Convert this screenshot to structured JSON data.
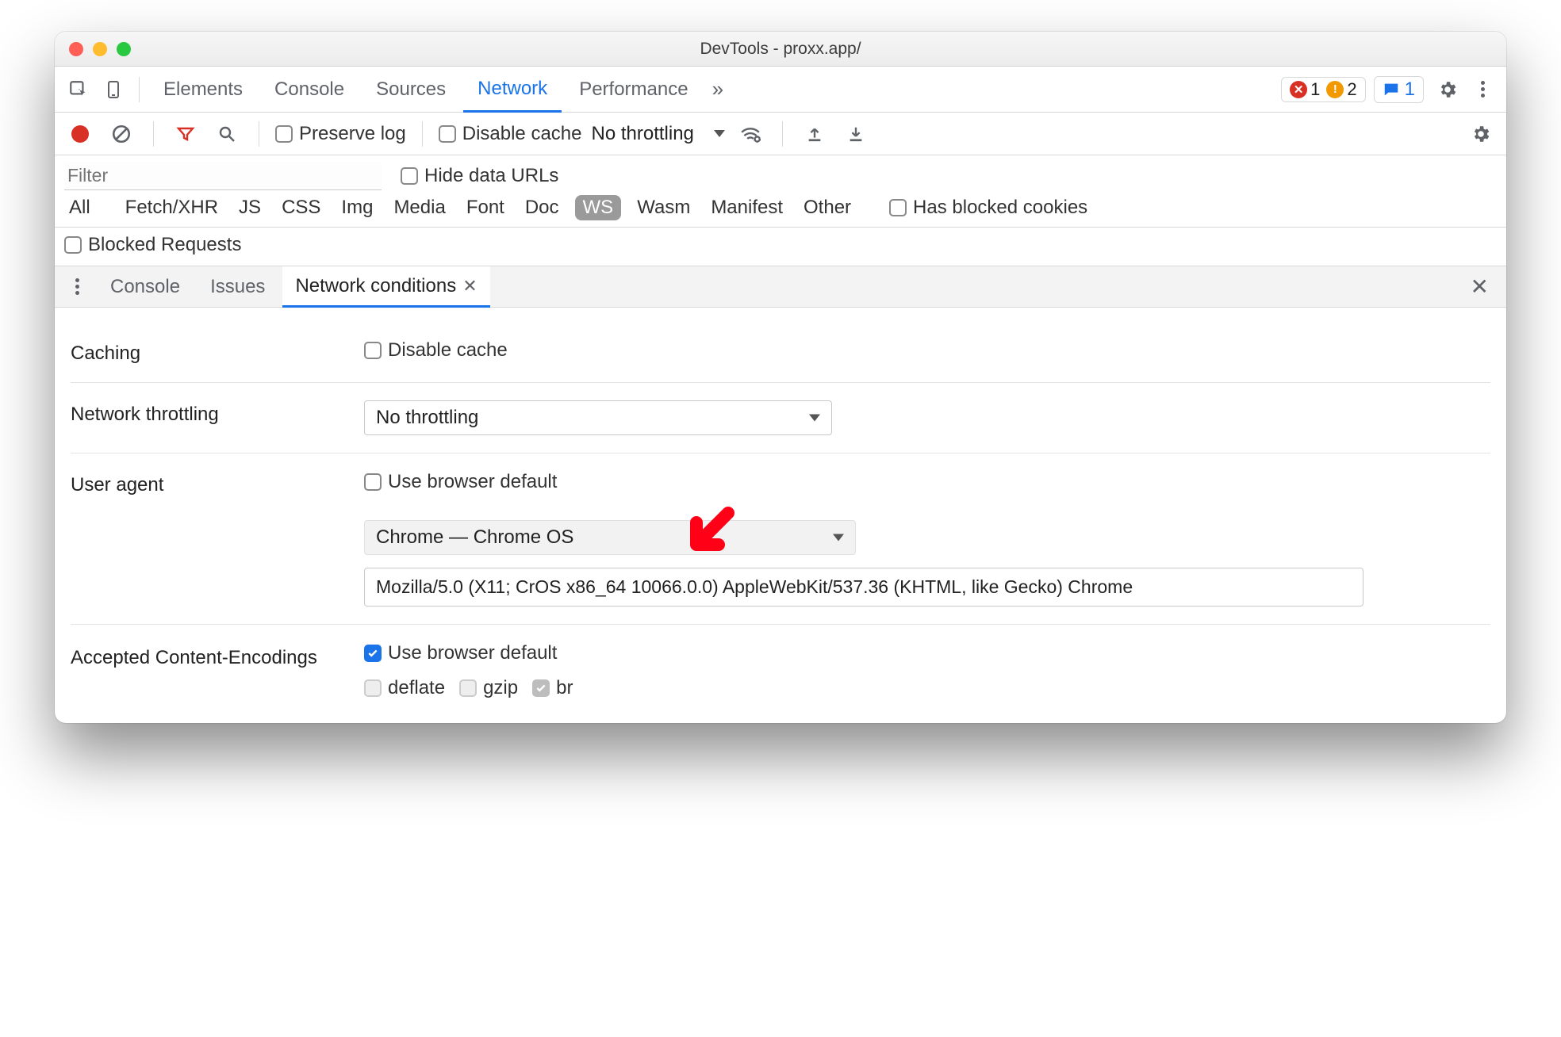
{
  "window": {
    "title": "DevTools - proxx.app/"
  },
  "main_tabs": {
    "items": [
      "Elements",
      "Console",
      "Sources",
      "Network",
      "Performance"
    ],
    "active": "Network",
    "overflow_icon": "»",
    "error_count": "1",
    "warn_count": "2",
    "msg_count": "1"
  },
  "net_toolbar": {
    "preserve_log": "Preserve log",
    "disable_cache": "Disable cache",
    "throttling": "No throttling"
  },
  "filter": {
    "placeholder": "Filter",
    "hide_data_urls": "Hide data URLs",
    "chips": [
      "All",
      "Fetch/XHR",
      "JS",
      "CSS",
      "Img",
      "Media",
      "Font",
      "Doc",
      "WS",
      "Wasm",
      "Manifest",
      "Other"
    ],
    "has_blocked": "Has blocked cookies",
    "blocked_requests": "Blocked Requests"
  },
  "drawer": {
    "tabs": [
      "Console",
      "Issues",
      "Network conditions"
    ],
    "active": "Network conditions"
  },
  "conditions": {
    "caching_label": "Caching",
    "caching_checkbox": "Disable cache",
    "throttling_label": "Network throttling",
    "throttling_value": "No throttling",
    "ua_label": "User agent",
    "ua_default": "Use browser default",
    "ua_select": "Chrome — Chrome OS",
    "ua_string": "Mozilla/5.0 (X11; CrOS x86_64 10066.0.0) AppleWebKit/537.36 (KHTML, like Gecko) Chrome",
    "enc_label": "Accepted Content-Encodings",
    "enc_default": "Use browser default",
    "enc_opts": [
      "deflate",
      "gzip",
      "br"
    ]
  }
}
